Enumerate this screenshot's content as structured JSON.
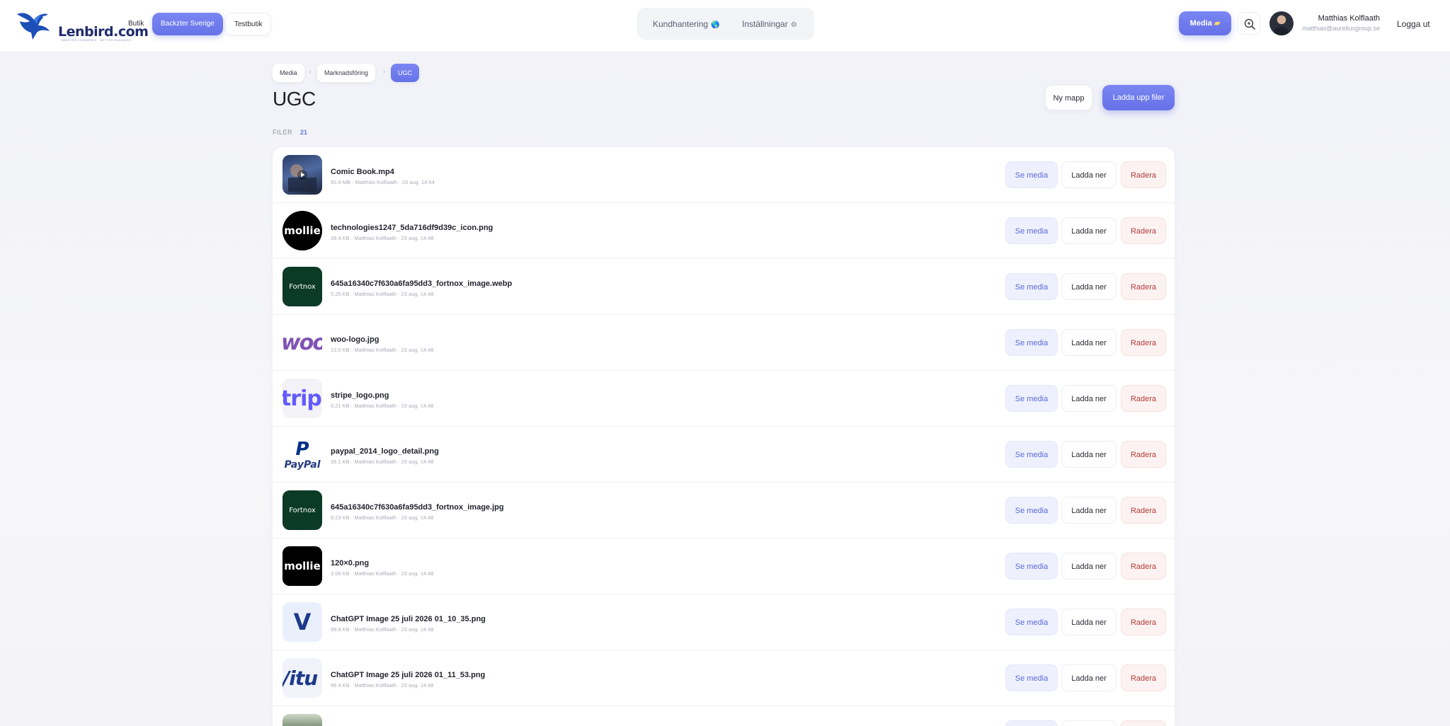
{
  "header": {
    "logo_text": "Lenbird.com",
    "logo_tagline": "SMARTER COMMERCE · BETTER BUSINESS",
    "stores": [
      {
        "label": "Butik",
        "active": false
      },
      {
        "label": "Backzter Sverige",
        "active": true
      },
      {
        "label": "Testbutik",
        "active": false
      }
    ],
    "nav": [
      {
        "label": "Kundhantering",
        "icon": "globe-icon",
        "glyph": "🌎"
      },
      {
        "label": "Inställningar",
        "icon": "gear-icon",
        "glyph": "⚙"
      }
    ],
    "media_button": "Media",
    "user": {
      "name": "Matthias Kolflaath",
      "email": "matthias@aureliusgroup.se"
    },
    "logout": "Logga ut"
  },
  "breadcrumb": [
    "Media",
    "Marknadsföring",
    "UGC"
  ],
  "page": {
    "title": "UGC",
    "new_folder": "Ny mapp",
    "upload": "Ladda upp filer",
    "files_label": "FILER",
    "files_count": "21"
  },
  "actions": {
    "view": "Se media",
    "download": "Ladda ner",
    "delete": "Radera"
  },
  "files": [
    {
      "name": "Comic Book.mp4",
      "meta": "50.9 MB · Matthias Kolflaath · 23 aug. 14:54",
      "thumb": "video"
    },
    {
      "name": "technologies1247_5da716df9d39c_icon.png",
      "meta": "28.4 KB · Matthias Kolflaath · 23 aug. 14:48",
      "thumb": "mollie",
      "thumb_text": "mollie"
    },
    {
      "name": "645a16340c7f630a6fa95dd3_fortnox_image.webp",
      "meta": "5.25 KB · Matthias Kolflaath · 23 aug. 14:48",
      "thumb": "fortnox",
      "thumb_text": "Fortnox"
    },
    {
      "name": "woo-logo.jpg",
      "meta": "13.0 KB · Matthias Kolflaath · 23 aug. 14:48",
      "thumb": "woo",
      "thumb_text": "woo"
    },
    {
      "name": "stripe_logo.png",
      "meta": "6.21 KB · Matthias Kolflaath · 23 aug. 14:48",
      "thumb": "stripe",
      "thumb_text": "tripe"
    },
    {
      "name": "paypal_2014_logo_detail.png",
      "meta": "35.1 KB · Matthias Kolflaath · 23 aug. 14:48",
      "thumb": "paypal",
      "thumb_text": "PayPal"
    },
    {
      "name": "645a16340c7f630a6fa95dd3_fortnox_image.jpg",
      "meta": "8.23 KB · Matthias Kolflaath · 23 aug. 14:48",
      "thumb": "fortnox",
      "thumb_text": "Fortnox"
    },
    {
      "name": "120×0.png",
      "meta": "3.06 KB · Matthias Kolflaath · 23 aug. 14:48",
      "thumb": "mollie",
      "thumb_text": "mollie"
    },
    {
      "name": "ChatGPT Image 25 juli 2026 01_10_35.png",
      "meta": "99.8 KB · Matthias Kolflaath · 23 aug. 14:48",
      "thumb": "v",
      "thumb_text": "V"
    },
    {
      "name": "ChatGPT Image 25 juli 2026 01_11_53.png",
      "meta": "96.9 KB · Matthias Kolflaath · 23 aug. 14:48",
      "thumb": "vitu",
      "thumb_text": "/itu"
    },
    {
      "name": "",
      "meta": "",
      "thumb": "photo"
    }
  ],
  "colors": {
    "accent": "#6673e8",
    "danger": "#b23a3a",
    "fortnox_bg": "#0b3a26"
  }
}
